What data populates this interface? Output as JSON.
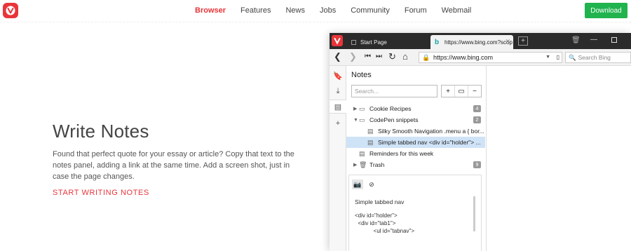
{
  "site_nav": {
    "links": [
      {
        "label": "Browser",
        "active": true
      },
      {
        "label": "Features"
      },
      {
        "label": "News"
      },
      {
        "label": "Jobs"
      },
      {
        "label": "Community"
      },
      {
        "label": "Forum"
      },
      {
        "label": "Webmail"
      }
    ],
    "download_label": "Download",
    "accent_color": "#e8353a",
    "download_color": "#20b34e"
  },
  "hero": {
    "title": "Write Notes",
    "description": "Found that perfect quote for your essay or article? Copy that text to the notes panel, adding a link at the same time. Add a screen shot, just in case the page changes.",
    "cta": "START WRITING NOTES"
  },
  "browser": {
    "tabs": [
      {
        "label": "Start Page",
        "icon": "grid-icon"
      },
      {
        "label": "https://www.bing.com?scop",
        "icon": "bing-icon"
      }
    ],
    "url": "https://www.bing.com",
    "search_placeholder": "Search Bing",
    "notes": {
      "title": "Notes",
      "search_placeholder": "Search...",
      "items": [
        {
          "label": "Cookie Recipes",
          "type": "folder",
          "count": "4",
          "expanded": false
        },
        {
          "label": "CodePen snippets",
          "type": "folder",
          "count": "2",
          "expanded": true
        },
        {
          "label": "Silky Smooth Navigation .menu a { bor...",
          "type": "note"
        },
        {
          "label": "Simple tabbed nav <div id=\"holder\"> ...",
          "type": "note",
          "selected": true
        },
        {
          "label": "Reminders for this week",
          "type": "note"
        },
        {
          "label": "Trash",
          "type": "trash",
          "count": "9"
        }
      ],
      "editor": {
        "title": "Simple tabbed nav",
        "code": "<div id=\"holder\">\n  <div id=\"tab1\">\n            <ul id=\"tabnav\">"
      }
    }
  }
}
